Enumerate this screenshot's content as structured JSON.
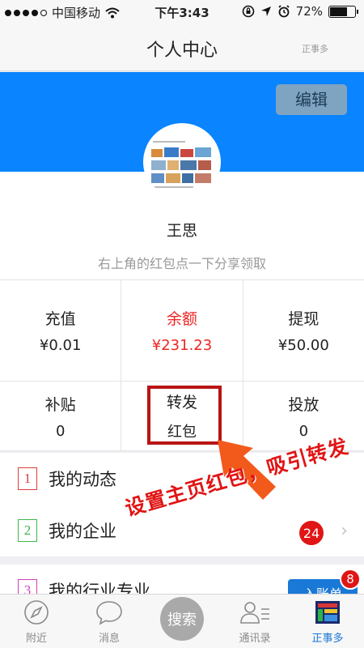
{
  "status_bar": {
    "carrier": "中国移动",
    "time": "下午3:43",
    "battery": "72%",
    "battery_level": 0.72
  },
  "navbar": {
    "title": "个人中心",
    "brand": "正事多"
  },
  "header": {
    "edit_label": "编辑",
    "username": "王思",
    "subtitle": "右上角的红包点一下分享领取"
  },
  "stats": {
    "row1": [
      {
        "label": "充值",
        "value": "¥0.01"
      },
      {
        "label": "余额",
        "value": "¥231.23"
      },
      {
        "label": "提现",
        "value": "¥50.00"
      }
    ],
    "row2": [
      {
        "label": "补贴",
        "value": "0"
      },
      {
        "label": "转发",
        "value": "红包"
      },
      {
        "label": "投放",
        "value": "0"
      }
    ]
  },
  "list": [
    {
      "number": "1",
      "label": "我的动态",
      "color": "#e03c3c"
    },
    {
      "number": "2",
      "label": "我的企业",
      "color": "#3cb84a",
      "badge": "24"
    },
    {
      "number": "3",
      "label": "我的行业专业",
      "color": "#d23fb4",
      "button": "入账单",
      "button_badge": "8"
    }
  ],
  "annotation": {
    "text": "设置主页红包，吸引转发",
    "color": "#e01515"
  },
  "tabbar": [
    {
      "label": "附近",
      "icon": "compass-icon"
    },
    {
      "label": "消息",
      "icon": "chat-bubble-icon"
    },
    {
      "label": "搜索",
      "icon": "search-circle"
    },
    {
      "label": "通讯录",
      "icon": "contacts-icon"
    },
    {
      "label": "正事多",
      "icon": "app-logo-icon",
      "active": true
    }
  ],
  "colors": {
    "banner": "#0a84ff",
    "accent_red": "#f02424",
    "tab_active": "#1a78d6"
  }
}
